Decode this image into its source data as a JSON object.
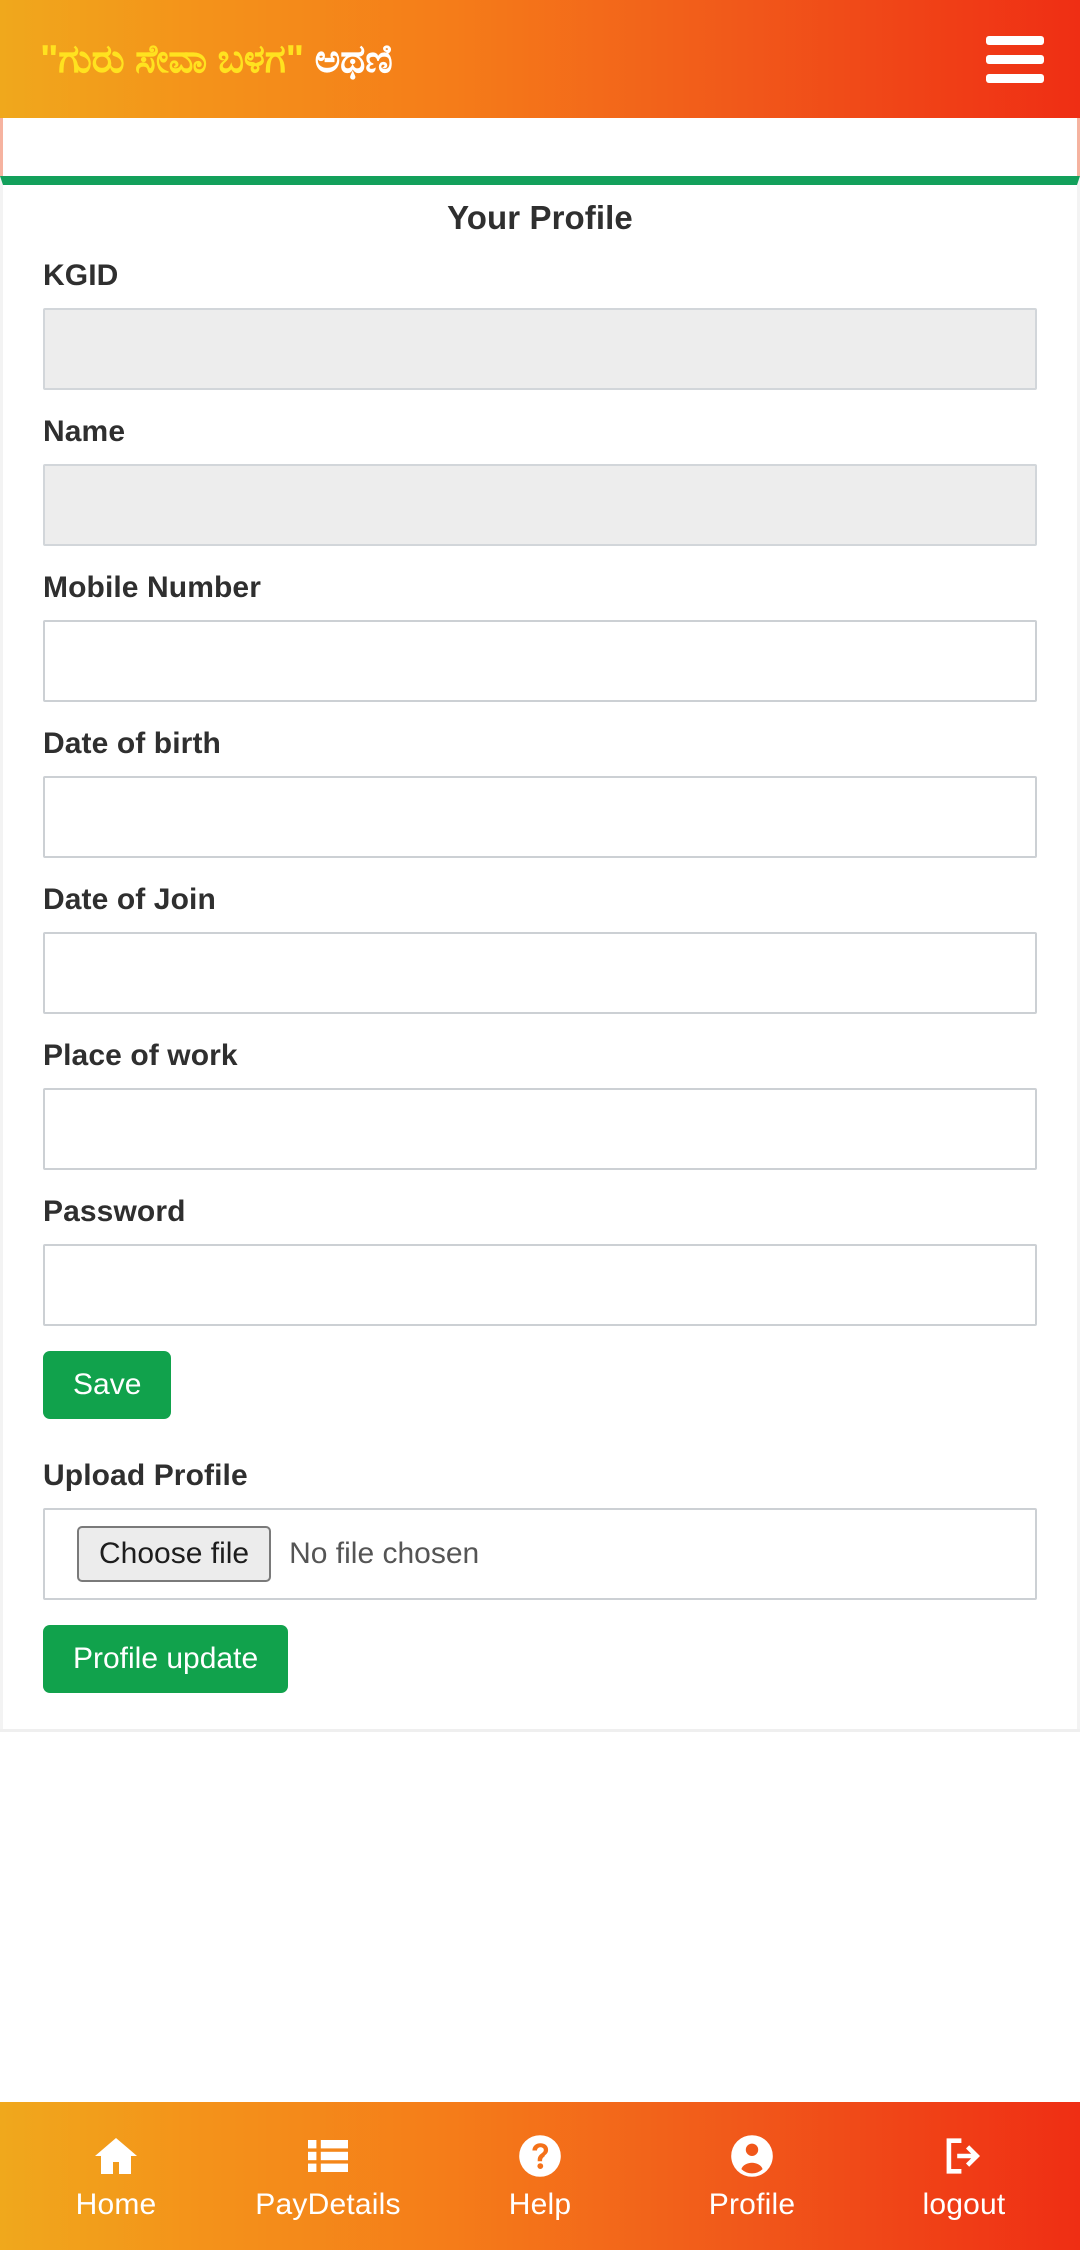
{
  "header": {
    "brand_quoted": "\"ಗುರು ಸೇವಾ ಬಳಗ\"",
    "brand_place": "ಅಥಣಿ",
    "menu_icon": "hamburger-icon"
  },
  "colors": {
    "header_gradient_start": "#f0a81c",
    "header_gradient_end": "#ef2e14",
    "brand_yellow": "#ffe21f",
    "accent_green": "#13a05b",
    "button_green": "#11a24c",
    "field_border": "#ccd0d4",
    "disabled_field_bg": "#ededed"
  },
  "profile_card": {
    "title": "Your Profile",
    "fields": [
      {
        "label": "KGID",
        "value": "",
        "placeholder": "",
        "disabled": true,
        "type": "text",
        "name": "kgid"
      },
      {
        "label": "Name",
        "value": "",
        "placeholder": "",
        "disabled": true,
        "type": "text",
        "name": "name"
      },
      {
        "label": "Mobile Number",
        "value": "",
        "placeholder": "",
        "disabled": false,
        "type": "text",
        "name": "mobile-number"
      },
      {
        "label": "Date of birth",
        "value": "",
        "placeholder": "",
        "disabled": false,
        "type": "text",
        "name": "date-of-birth"
      },
      {
        "label": "Date of Join",
        "value": "",
        "placeholder": "",
        "disabled": false,
        "type": "text",
        "name": "date-of-join"
      },
      {
        "label": "Place of work",
        "value": "",
        "placeholder": "",
        "disabled": false,
        "type": "text",
        "name": "place-of-work"
      },
      {
        "label": "Password",
        "value": "",
        "placeholder": "",
        "disabled": false,
        "type": "password",
        "name": "password"
      }
    ],
    "save_label": "Save",
    "upload_label": "Upload Profile",
    "choose_file_label": "Choose file",
    "file_status": "No file chosen",
    "profile_update_label": "Profile update"
  },
  "bottom_nav": [
    {
      "label": "Home",
      "icon": "home-icon"
    },
    {
      "label": "PayDetails",
      "icon": "list-icon"
    },
    {
      "label": "Help",
      "icon": "question-circle-icon"
    },
    {
      "label": "Profile",
      "icon": "user-circle-icon"
    },
    {
      "label": "logout",
      "icon": "logout-icon"
    }
  ]
}
